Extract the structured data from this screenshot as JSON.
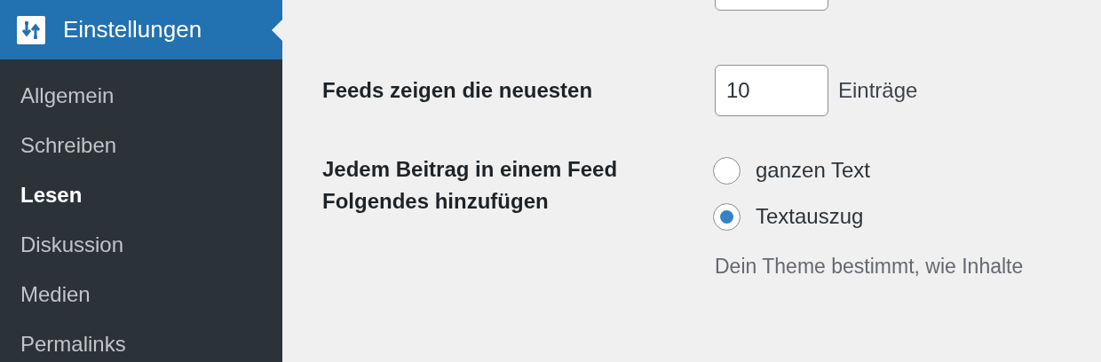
{
  "sidebar": {
    "header": {
      "label": "Einstellungen"
    },
    "items": [
      {
        "label": "Allgemein",
        "selected": false
      },
      {
        "label": "Schreiben",
        "selected": false
      },
      {
        "label": "Lesen",
        "selected": true
      },
      {
        "label": "Diskussion",
        "selected": false
      },
      {
        "label": "Medien",
        "selected": false
      },
      {
        "label": "Permalinks",
        "selected": false
      }
    ]
  },
  "settings": [
    {
      "kind": "number",
      "label": "Feeds zeigen die neuesten",
      "value": "10",
      "suffix": "Einträge"
    },
    {
      "kind": "radio",
      "label": "Jedem Beitrag in einem Feed Folgendes hinzufügen",
      "options": [
        {
          "label": "ganzen Text",
          "selected": false
        },
        {
          "label": "Textauszug",
          "selected": true
        }
      ],
      "description": "Dein Theme bestimmt, wie Inhalte"
    }
  ]
}
